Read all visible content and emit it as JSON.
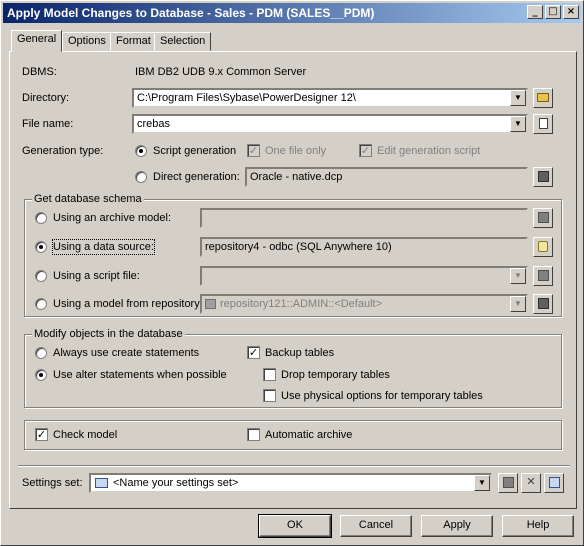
{
  "window": {
    "title": "Apply Model Changes to Database - Sales - PDM (SALES__PDM)",
    "controls": {
      "minimize": "_",
      "maximize": "□",
      "close": "×"
    }
  },
  "tabs": [
    "General",
    "Options",
    "Format",
    "Selection"
  ],
  "general": {
    "dbms_label": "DBMS:",
    "dbms_value": "IBM DB2 UDB 9.x Common Server",
    "directory_label": "Directory:",
    "directory_value": "C:\\Program Files\\Sybase\\PowerDesigner 12\\",
    "filename_label": "File name:",
    "filename_value": "crebas",
    "generation_type_label": "Generation type:",
    "script_generation_label": "Script generation",
    "one_file_only_label": "One file only",
    "edit_generation_script_label": "Edit generation script",
    "direct_generation_label": "Direct generation:",
    "direct_generation_value": "Oracle - native.dcp"
  },
  "schema_group": {
    "title": "Get database schema",
    "archive_label": "Using an archive model:",
    "archive_value": "",
    "datasource_label": "Using a data source:",
    "datasource_value": "repository4 - odbc (SQL Anywhere 10)",
    "script_file_label": "Using a script file:",
    "script_file_value": "",
    "repository_label": "Using a model from repository:",
    "repository_value": "repository121::ADMIN::<Default>"
  },
  "modify_group": {
    "title": "Modify objects in the database",
    "create_label": "Always use create statements",
    "alter_label": "Use alter statements when possible",
    "backup_label": "Backup tables",
    "drop_temp_label": "Drop temporary tables",
    "physical_label": "Use physical options for temporary tables"
  },
  "check": {
    "check_model_label": "Check model",
    "auto_archive_label": "Automatic archive"
  },
  "settings": {
    "label": "Settings set:",
    "value": "<Name your settings set>"
  },
  "buttons": {
    "ok": "OK",
    "cancel": "Cancel",
    "apply": "Apply",
    "help": "Help"
  }
}
